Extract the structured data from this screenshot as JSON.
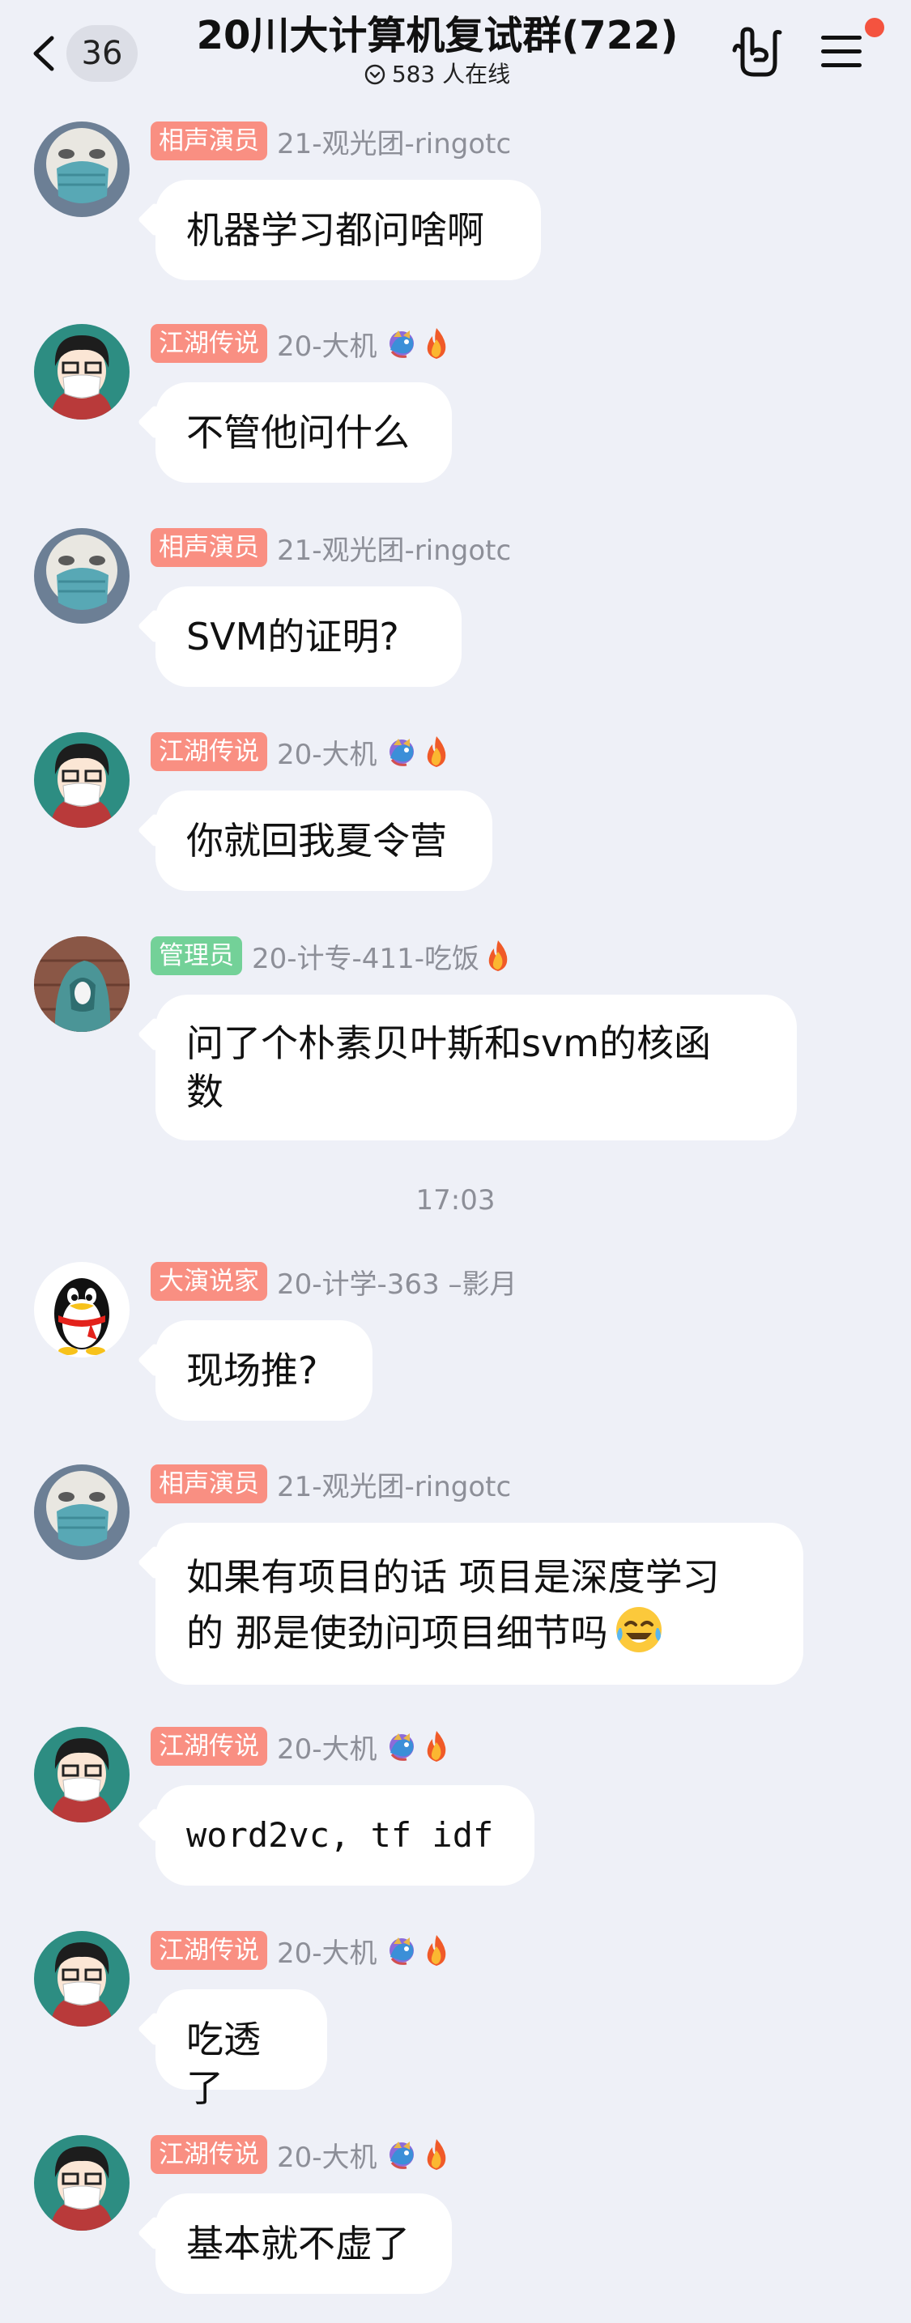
{
  "header": {
    "back_count": "36",
    "title": "20川大计算机复试群(722)",
    "online": "583 人在线"
  },
  "messages": [
    {
      "tag": "相声演员",
      "tag_color": "#f98f82",
      "name": "21-观光团-ringotc",
      "text": "机器学习都问啥啊",
      "avatar": "mask-avatar"
    },
    {
      "tag": "江湖传说",
      "tag_color": "#f98f82",
      "name": "20-大机",
      "text": "不管他问什么",
      "avatar": "anime-avatar"
    },
    {
      "tag": "相声演员",
      "tag_color": "#f98f82",
      "name": "21-观光团-ringotc",
      "text": "SVM的证明?",
      "avatar": "mask-avatar"
    },
    {
      "tag": "江湖传说",
      "tag_color": "#f98f82",
      "name": "20-大机",
      "text": "你就回我夏令营",
      "avatar": "anime-avatar"
    },
    {
      "tag": "管理员",
      "tag_color": "#73d198",
      "name": "20-计专-411-吃饭",
      "text_line1": "问了个朴素贝叶斯和svm的核函",
      "text_line2": "数",
      "avatar": "hoodie-avatar"
    },
    {
      "tag": "大演说家",
      "tag_color": "#f98f82",
      "name": "20-计学-363 –影月",
      "text": "现场推?",
      "avatar": "penguin-avatar"
    },
    {
      "tag": "相声演员",
      "tag_color": "#f98f82",
      "name": "21-观光团-ringotc",
      "text_line1": "如果有项目的话 项目是深度学习",
      "text_line2": "的 那是使劲问项目细节吗",
      "avatar": "mask-avatar"
    },
    {
      "tag": "江湖传说",
      "tag_color": "#f98f82",
      "name": "20-大机",
      "text": "word2vc, tf idf",
      "avatar": "anime-avatar"
    },
    {
      "tag": "江湖传说",
      "tag_color": "#f98f82",
      "name": "20-大机",
      "text": "吃透了",
      "avatar": "anime-avatar"
    },
    {
      "tag": "江湖传说",
      "tag_color": "#f98f82",
      "name": "20-大机",
      "text": "基本就不虚了",
      "avatar": "anime-avatar"
    }
  ],
  "timestamp": "17:03",
  "colors": {
    "background": "#eef0f7",
    "tag_red": "#f98f82",
    "tag_green": "#73d198",
    "notify_dot": "#f4533f"
  }
}
